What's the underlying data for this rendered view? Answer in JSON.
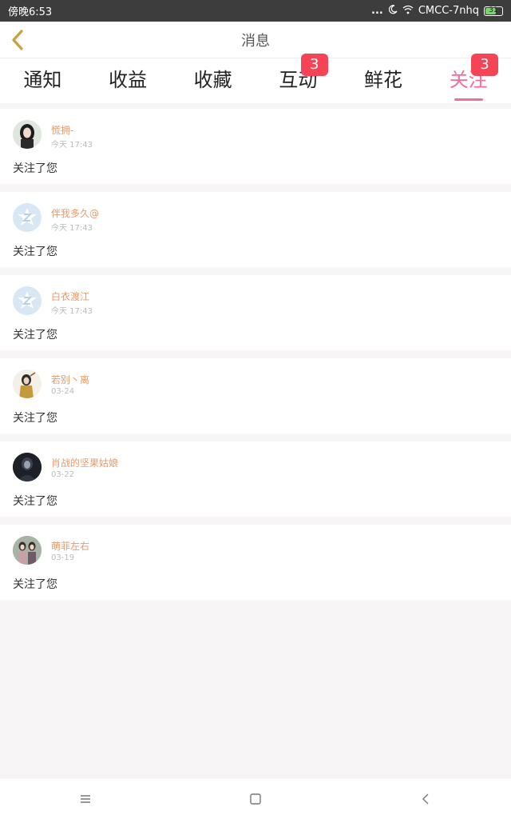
{
  "status_bar": {
    "time": "傍晚6:53",
    "dots": "...",
    "moon_icon": "moon-icon",
    "wifi_icon": "wifi-icon",
    "carrier": "CMCC-7nhq",
    "battery": "31"
  },
  "header": {
    "back_icon": "chevron-left-icon",
    "title": "消息"
  },
  "tabs": [
    {
      "label": "通知",
      "badge": null
    },
    {
      "label": "收益",
      "badge": null
    },
    {
      "label": "收藏",
      "badge": null
    },
    {
      "label": "互动",
      "badge": "3"
    },
    {
      "label": "鲜花",
      "badge": null
    },
    {
      "label": "关注",
      "badge": "3",
      "active": true
    }
  ],
  "items": [
    {
      "name": "慌拥-",
      "time": "今天 17:43",
      "text": "关注了您",
      "avatar": "photo-avatar-girl"
    },
    {
      "name": "伴我多久@",
      "time": "今天 17:43",
      "text": "关注了您",
      "avatar": "default-star-avatar"
    },
    {
      "name": "白衣渡江",
      "time": "今天 17:43",
      "text": "关注了您",
      "avatar": "default-star-avatar"
    },
    {
      "name": "若别丶离",
      "time": "03-24",
      "text": "关注了您",
      "avatar": "photo-avatar-figure"
    },
    {
      "name": "肖战的坚果姑娘",
      "time": "03-22",
      "text": "关注了您",
      "avatar": "photo-avatar-dark"
    },
    {
      "name": "萌菲左右",
      "time": "03-19",
      "text": "关注了您",
      "avatar": "photo-avatar-couple"
    }
  ],
  "nav_bar": {
    "menu_icon": "menu-icon",
    "home_icon": "square-icon",
    "back_icon": "back-triangle-icon"
  },
  "colors": {
    "accent": "#f36c9a",
    "badge": "#f44456",
    "username": "#e89a6a"
  }
}
